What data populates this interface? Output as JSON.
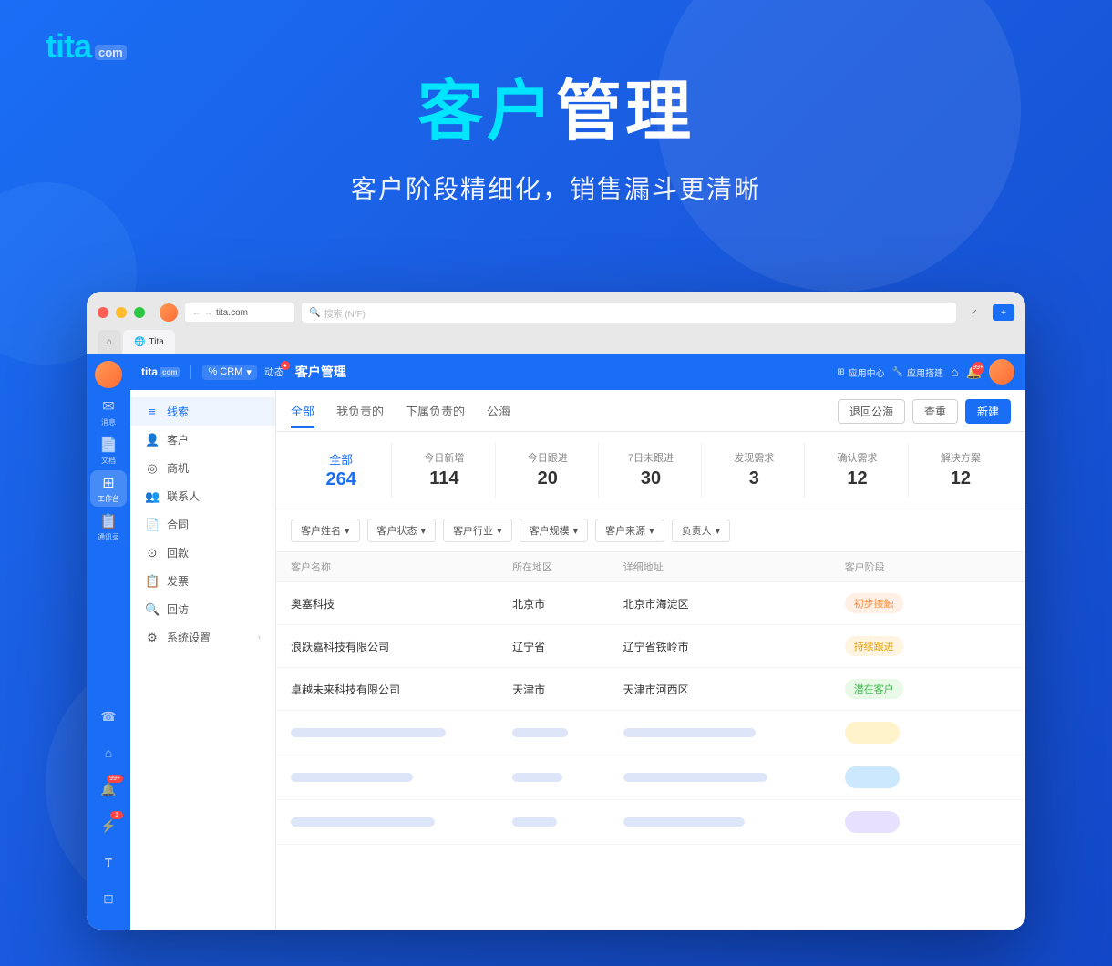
{
  "brand": {
    "logo_text": "tita",
    "logo_com": "com",
    "tagline_highlight": "客户",
    "tagline_main": "管理",
    "subtitle": "客户阶段精细化，销售漏斗更清晰"
  },
  "browser": {
    "tab_label": "Tita",
    "address": "tita.com",
    "search_placeholder": "搜索 (N/F)",
    "action_btn1": "✓",
    "action_btn2": "+"
  },
  "app_header": {
    "logo": "tita",
    "logo_com": "com",
    "crm_label": "% CRM",
    "nav_dynamic": "动态",
    "page_title": "客户管理",
    "app_center": "应用中心",
    "app_build": "应用搭建",
    "home_icon": "⌂",
    "notification_count": "99+"
  },
  "nav_sidebar": {
    "items": [
      {
        "id": "pipeline",
        "icon": "≡",
        "label": "线索",
        "active": true
      },
      {
        "id": "customer",
        "icon": "👤",
        "label": "客户",
        "active": false
      },
      {
        "id": "opportunity",
        "icon": "◎",
        "label": "商机",
        "active": false
      },
      {
        "id": "contact",
        "icon": "👥",
        "label": "联系人",
        "active": false
      },
      {
        "id": "contract",
        "icon": "📄",
        "label": "合同",
        "active": false
      },
      {
        "id": "payment",
        "icon": "💰",
        "label": "回款",
        "active": false
      },
      {
        "id": "invoice",
        "icon": "🧾",
        "label": "发票",
        "active": false
      },
      {
        "id": "visit",
        "icon": "🔍",
        "label": "回访",
        "active": false
      },
      {
        "id": "settings",
        "icon": "⚙",
        "label": "系统设置",
        "active": false
      }
    ]
  },
  "tabs": {
    "items": [
      {
        "label": "全部",
        "active": true
      },
      {
        "label": "我负责的",
        "active": false
      },
      {
        "label": "下属负责的",
        "active": false
      },
      {
        "label": "公海",
        "active": false
      }
    ],
    "btn_return": "退回公海",
    "btn_duplicate": "查重",
    "btn_new": "新建"
  },
  "stats": {
    "all_label": "全部",
    "all_value": "264",
    "today_new_label": "今日新增",
    "today_new_value": "114",
    "today_followup_label": "今日跟进",
    "today_followup_value": "20",
    "seven_day_label": "7日未跟进",
    "seven_day_value": "30",
    "find_demand_label": "发现需求",
    "find_demand_value": "3",
    "confirm_demand_label": "确认需求",
    "confirm_demand_value": "12",
    "solution_label": "解决方案",
    "solution_value": "12"
  },
  "filters": {
    "items": [
      "客户姓名",
      "客户状态",
      "客户行业",
      "客户规模",
      "客户来源",
      "负责人"
    ]
  },
  "table": {
    "headers": [
      "客户名称",
      "所在地区",
      "详细地址",
      "客户阶段"
    ],
    "rows": [
      {
        "name": "奥塞科技",
        "region": "北京市",
        "address": "北京市海淀区",
        "stage": "初步接触",
        "stage_type": "initial"
      },
      {
        "name": "浪跃嘉科技有限公司",
        "region": "辽宁省",
        "address": "辽宁省铁岭市",
        "stage": "持续跟进",
        "stage_type": "followup"
      },
      {
        "name": "卓越未来科技有限公司",
        "region": "天津市",
        "address": "天津市河西区",
        "stage": "潜在客户",
        "stage_type": "potential"
      }
    ],
    "skeleton_rows": [
      {
        "stage_color": "yellow"
      },
      {
        "stage_color": "blue"
      },
      {
        "stage_color": "purple"
      }
    ]
  },
  "icon_sidebar": {
    "top_items": [
      {
        "icon": "✉",
        "label": "消息"
      },
      {
        "icon": "📄",
        "label": "文档"
      },
      {
        "icon": "⊞",
        "label": "工作台",
        "active": true
      },
      {
        "icon": "📋",
        "label": "通讯录"
      }
    ],
    "bottom_items": [
      {
        "icon": "☎",
        "label": ""
      },
      {
        "icon": "🔔",
        "label": "",
        "badge": ""
      },
      {
        "icon": "⊕",
        "label": "",
        "badge": "99+"
      },
      {
        "icon": "🔔",
        "label": "",
        "badge": "1"
      },
      {
        "icon": "T",
        "label": ""
      },
      {
        "icon": "⊟",
        "label": ""
      }
    ]
  }
}
